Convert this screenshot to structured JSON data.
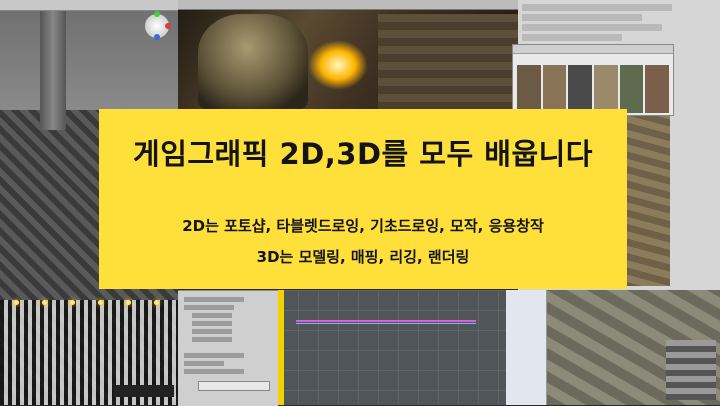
{
  "banner": {
    "title": "게임그래픽 2D,3D를 모두 배웁니다",
    "line1": "2D는 포토샵, 타블렛드로잉, 기초드로잉, 모작, 응용창작",
    "line2": "3D는 모델링, 매핑, 리깅, 랜더링"
  },
  "colors": {
    "banner_bg": "#ffe03a",
    "banner_text": "#141414"
  },
  "icons": {
    "scene_gizmo": "axis-gizmo-icon"
  }
}
